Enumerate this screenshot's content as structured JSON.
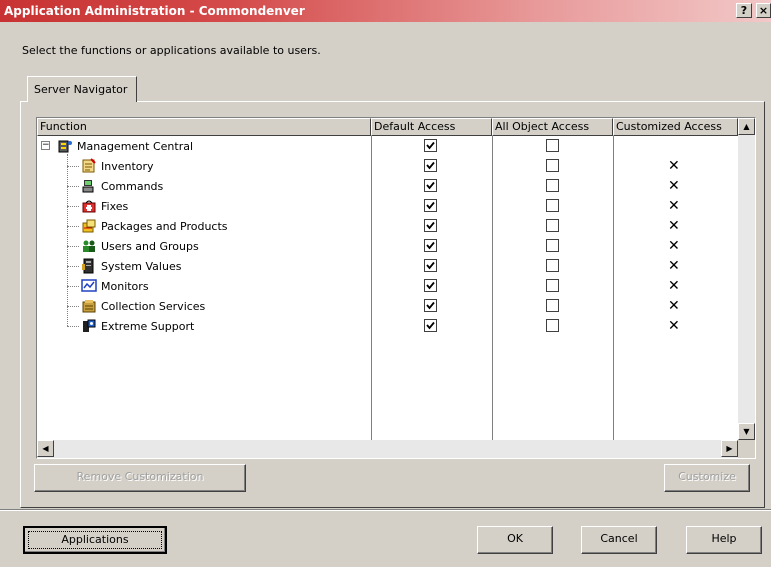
{
  "window": {
    "title": "Application Administration - Commondenver",
    "help_glyph": "?",
    "close_glyph": "×"
  },
  "instruction": "Select the functions or applications available to users.",
  "tab": {
    "label": "Server Navigator"
  },
  "table": {
    "columns": [
      "Function",
      "Default Access",
      "All Object Access",
      "Customized Access"
    ],
    "root": {
      "label": "Management Central",
      "expander": "−",
      "icon": "management-central-icon"
    },
    "rows": [
      {
        "label": "Inventory",
        "icon": "inventory-icon",
        "default_access": true,
        "all_object_access": false,
        "customized": true
      },
      {
        "label": "Commands",
        "icon": "commands-icon",
        "default_access": true,
        "all_object_access": false,
        "customized": true
      },
      {
        "label": "Fixes",
        "icon": "fixes-icon",
        "default_access": true,
        "all_object_access": false,
        "customized": true
      },
      {
        "label": "Packages and Products",
        "icon": "packages-icon",
        "default_access": true,
        "all_object_access": false,
        "customized": true
      },
      {
        "label": "Users and Groups",
        "icon": "users-groups-icon",
        "default_access": true,
        "all_object_access": false,
        "customized": true
      },
      {
        "label": "System Values",
        "icon": "system-values-icon",
        "default_access": true,
        "all_object_access": false,
        "customized": true
      },
      {
        "label": "Monitors",
        "icon": "monitors-icon",
        "default_access": true,
        "all_object_access": false,
        "customized": true
      },
      {
        "label": "Collection Services",
        "icon": "collection-services-icon",
        "default_access": true,
        "all_object_access": false,
        "customized": true
      },
      {
        "label": "Extreme Support",
        "icon": "extreme-support-icon",
        "default_access": true,
        "all_object_access": false,
        "customized": true
      }
    ],
    "customized_mark": "✕"
  },
  "buttons": {
    "remove_customization": "Remove Customization",
    "customize": "Customize",
    "applications": "Applications",
    "ok": "OK",
    "cancel": "Cancel",
    "help": "Help"
  },
  "colors": {
    "titlebar_start": "#c83232",
    "face": "#d4d0c8"
  }
}
